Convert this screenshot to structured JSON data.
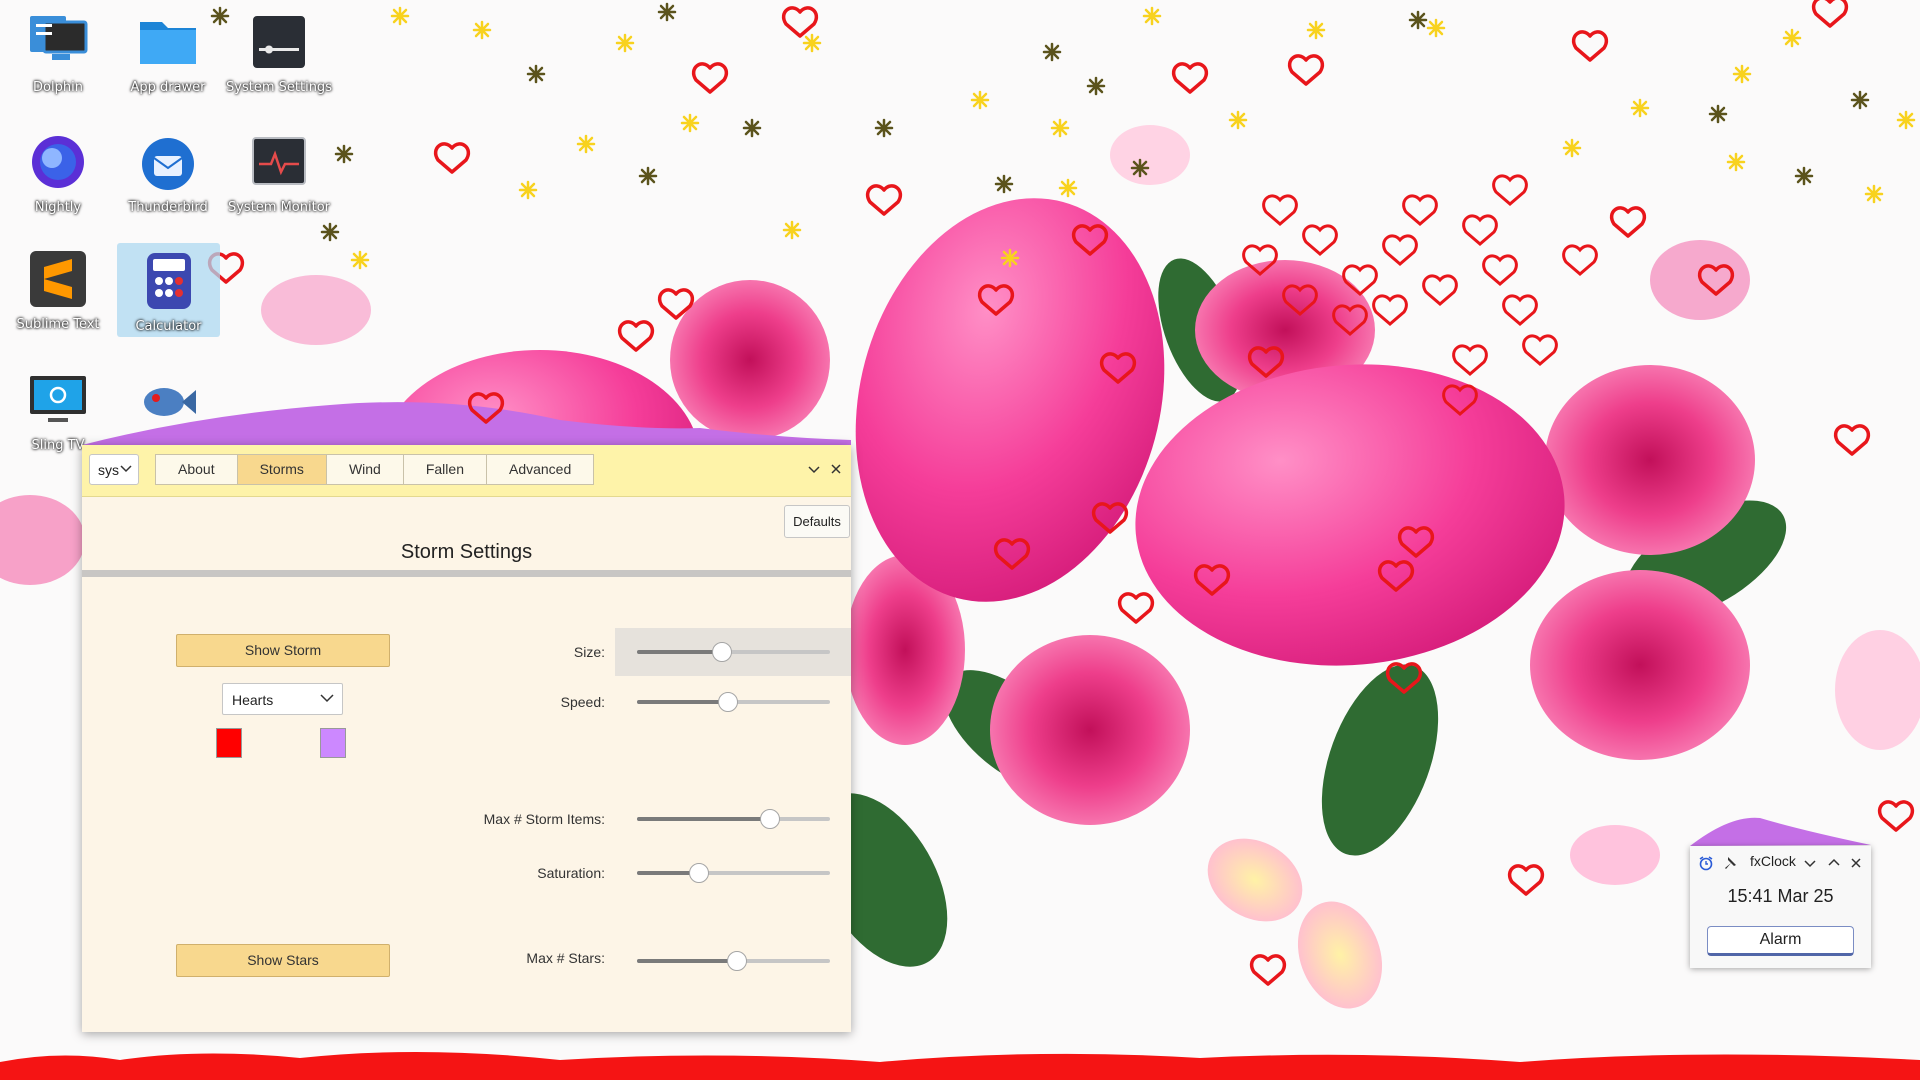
{
  "desktop": {
    "icons": [
      {
        "label": "Dolphin",
        "icon": "folder-manager-icon"
      },
      {
        "label": "App drawer",
        "icon": "folder-icon"
      },
      {
        "label": "System Settings",
        "icon": "settings-icon"
      },
      {
        "label": "Nightly",
        "icon": "firefox-nightly-icon"
      },
      {
        "label": "Thunderbird",
        "icon": "thunderbird-icon"
      },
      {
        "label": "System Monitor",
        "icon": "system-monitor-icon"
      },
      {
        "label": "Sublime Text",
        "icon": "sublime-text-icon"
      },
      {
        "label": "Calculator",
        "icon": "calculator-icon"
      },
      {
        "label": "Sling TV",
        "icon": "sling-tv-icon"
      },
      {
        "label": "",
        "icon": "fish-icon"
      }
    ]
  },
  "settings_window": {
    "profile_select": "sys",
    "tabs": [
      "About",
      "Storms",
      "Wind",
      "Fallen",
      "Advanced"
    ],
    "active_tab": "Storms",
    "defaults_button": "Defaults",
    "heading": "Storm Settings",
    "show_storm_button": "Show Storm",
    "storm_type_select": "Hearts",
    "swatch_colors": [
      "#ff0000",
      "#cc88ff"
    ],
    "show_stars_button": "Show Stars",
    "sliders": [
      {
        "label": "Size:",
        "value": 0.44
      },
      {
        "label": "Speed:",
        "value": 0.47
      },
      {
        "label": "Max # Storm Items:",
        "value": 0.69
      },
      {
        "label": "Saturation:",
        "value": 0.32
      },
      {
        "label": "Max # Stars:",
        "value": 0.52
      }
    ]
  },
  "fxclock": {
    "title": "fxClock",
    "time": "15:41 Mar 25",
    "alarm_button": "Alarm"
  }
}
